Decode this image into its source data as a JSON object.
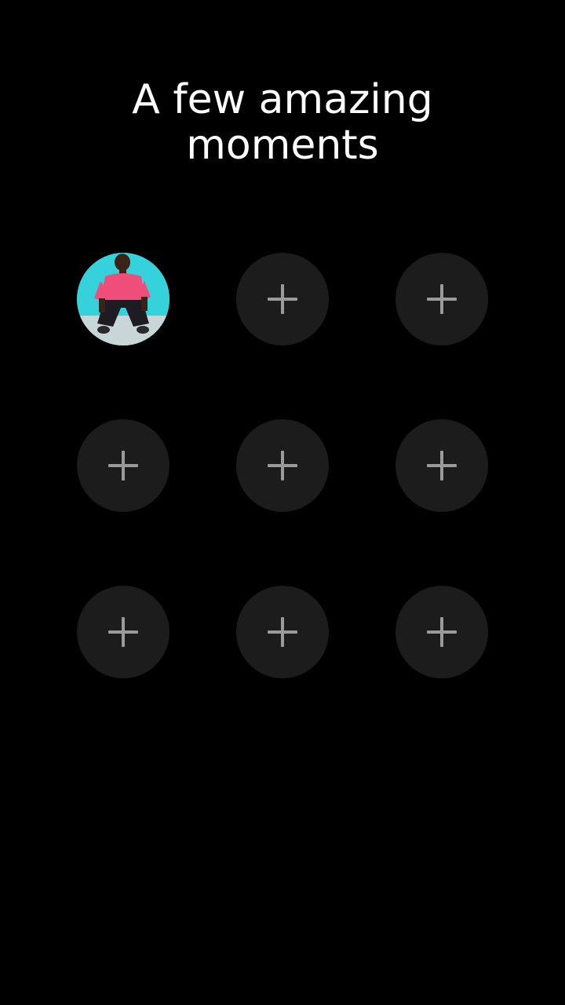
{
  "title": {
    "line1": "A few amazing",
    "line2": "moments"
  },
  "moments": {
    "slots": [
      {
        "state": "filled",
        "content": "photo of person in pink shirt"
      },
      {
        "state": "empty",
        "icon": "plus-icon"
      },
      {
        "state": "empty",
        "icon": "plus-icon"
      },
      {
        "state": "empty",
        "icon": "plus-icon"
      },
      {
        "state": "empty",
        "icon": "plus-icon"
      },
      {
        "state": "empty",
        "icon": "plus-icon"
      },
      {
        "state": "empty",
        "icon": "plus-icon"
      },
      {
        "state": "empty",
        "icon": "plus-icon"
      },
      {
        "state": "empty",
        "icon": "plus-icon"
      }
    ]
  },
  "colors": {
    "background": "#000000",
    "slot_fill": "#1c1c1c",
    "plus": "#9a9a9a",
    "title": "#ffffff"
  }
}
